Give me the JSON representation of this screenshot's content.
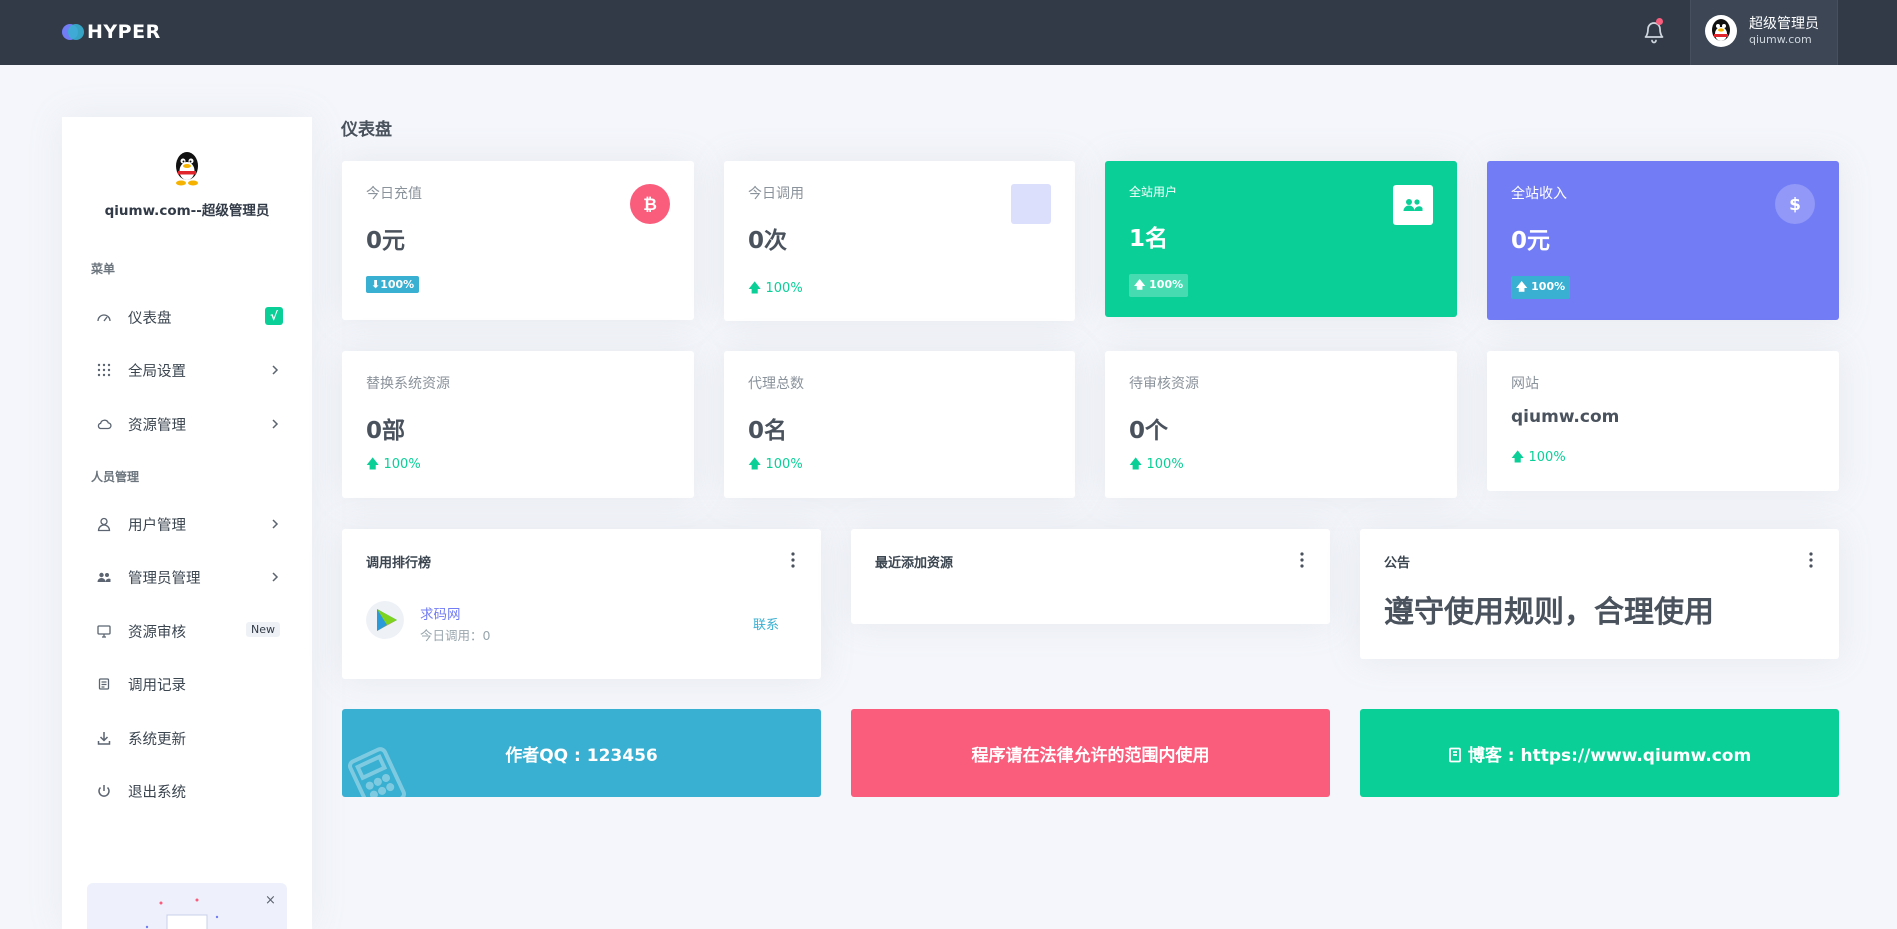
{
  "header": {
    "brand": "HYPER",
    "user_name": "超级管理员",
    "user_site": "qiumw.com"
  },
  "sidebar": {
    "user_label": "qiumw.com--超级管理员",
    "section_menu": "菜单",
    "section_people": "人员管理",
    "items": [
      {
        "label": "仪表盘",
        "icon": "gauge-icon",
        "badge": "√"
      },
      {
        "label": "全局设置",
        "icon": "grid-icon"
      },
      {
        "label": "资源管理",
        "icon": "cloud-icon"
      },
      {
        "label": "用户管理",
        "icon": "user-icon"
      },
      {
        "label": "管理员管理",
        "icon": "users-icon"
      },
      {
        "label": "资源审核",
        "icon": "monitor-icon",
        "badge": "New"
      },
      {
        "label": "调用记录",
        "icon": "receipt-icon"
      },
      {
        "label": "系统更新",
        "icon": "download-icon"
      },
      {
        "label": "退出系统",
        "icon": "power-icon"
      }
    ],
    "promo_close": "×"
  },
  "main": {
    "page_title": "仪表盘",
    "stats_row1": [
      {
        "label": "今日充值",
        "value": "0元",
        "pct": "100%",
        "icon": "bitcoin-icon"
      },
      {
        "label": "今日调用",
        "value": "0次",
        "pct": "100%",
        "icon": "square-icon"
      },
      {
        "label": "全站用户",
        "value": "1名",
        "pct": "100%",
        "icon": "users-icon"
      },
      {
        "label": "全站收入",
        "value": "0元",
        "pct": "100%",
        "icon": "dollar-icon"
      }
    ],
    "stats_row2": [
      {
        "label": "替换系统资源",
        "value": "0部",
        "pct": "100%"
      },
      {
        "label": "代理总数",
        "value": "0名",
        "pct": "100%"
      },
      {
        "label": "待审核资源",
        "value": "0个",
        "pct": "100%"
      },
      {
        "label": "网站",
        "value": "qiumw.com",
        "pct": "100%"
      }
    ],
    "ranking": {
      "title": "调用排行榜",
      "name": "求码网",
      "sub": "今日调用：0",
      "link": "联系"
    },
    "recent": {
      "title": "最近添加资源"
    },
    "notice": {
      "title": "公告",
      "text": "遵守使用规则，合理使用"
    },
    "banners": [
      {
        "text": "作者QQ : 123456"
      },
      {
        "text": "程序请在法律允许的范围内使用"
      },
      {
        "text": "博客 : https://www.qiumw.com"
      }
    ]
  },
  "colors": {
    "topbar": "#313a46",
    "green": "#0acf97",
    "purple": "#727cf5",
    "blue": "#39afd1",
    "red": "#fa5c7c"
  }
}
